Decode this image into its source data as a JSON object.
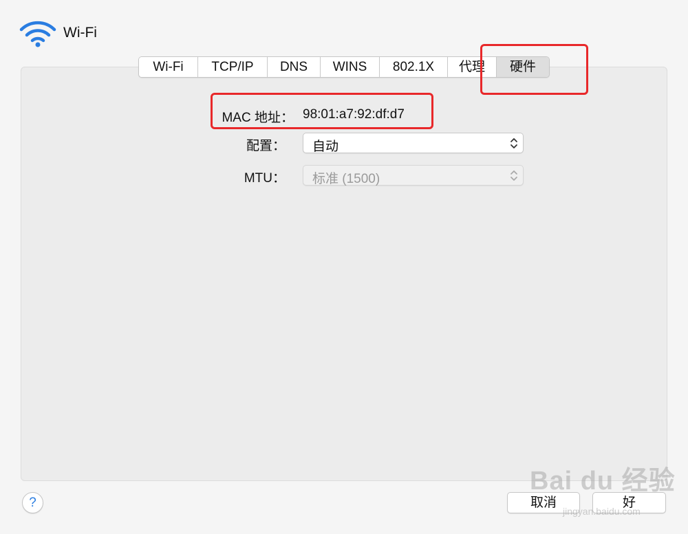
{
  "window": {
    "title": "Wi-Fi",
    "icon": "wifi-icon"
  },
  "tabs": [
    {
      "label": "Wi-Fi",
      "selected": false
    },
    {
      "label": "TCP/IP",
      "selected": false
    },
    {
      "label": "DNS",
      "selected": false
    },
    {
      "label": "WINS",
      "selected": false
    },
    {
      "label": "802.1X",
      "selected": false
    },
    {
      "label": "代理",
      "selected": false
    },
    {
      "label": "硬件",
      "selected": true
    }
  ],
  "hardware": {
    "mac_label": "MAC 地址：",
    "mac_value": "98:01:a7:92:df:d7",
    "config_label": "配置：",
    "config_value": "自动",
    "mtu_label": "MTU：",
    "mtu_value": "标准 (1500)"
  },
  "footer": {
    "help_label": "?",
    "cancel_label": "取消",
    "ok_label": "好"
  },
  "watermark": {
    "text": "Bai du 经验",
    "sub": "jingyan.baidu.com"
  },
  "colors": {
    "highlight": "#e8282a",
    "accent": "#2a7de1"
  }
}
